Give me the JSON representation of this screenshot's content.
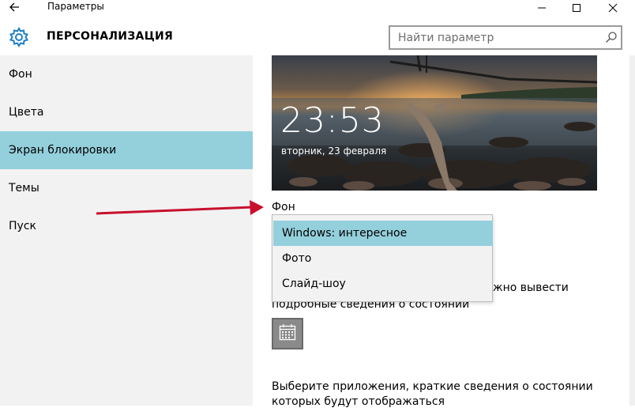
{
  "window": {
    "title": "Параметры"
  },
  "header": {
    "title": "ПЕРСОНАЛИЗАЦИЯ",
    "search_placeholder": "Найти параметр"
  },
  "sidebar": {
    "items": [
      {
        "label": "Фон",
        "active": false
      },
      {
        "label": "Цвета",
        "active": false
      },
      {
        "label": "Экран блокировки",
        "active": true
      },
      {
        "label": "Темы",
        "active": false
      },
      {
        "label": "Пуск",
        "active": false
      }
    ]
  },
  "lock_preview": {
    "time": "23:53",
    "date": "вторник, 23 февраля"
  },
  "background": {
    "label": "Фон",
    "options": [
      {
        "label": "Windows: интересное",
        "selected": true
      },
      {
        "label": "Фото",
        "selected": false
      },
      {
        "label": "Слайд-шоу",
        "selected": false
      }
    ]
  },
  "status": {
    "text_line1_right": "жно вывести",
    "text_line2": "подробные сведения о состоянии"
  },
  "apps": {
    "text_line1": "Выберите приложения, краткие сведения о состоянии",
    "text_line2": "которых будут отображаться"
  },
  "colors": {
    "accent": "#94cfdc",
    "sidebar_bg": "#f2f2f2",
    "arrow": "#c8102e"
  },
  "icons": {
    "back": "back-arrow-icon",
    "settings": "gear-icon",
    "search": "search-icon",
    "calendar": "calendar-icon"
  }
}
